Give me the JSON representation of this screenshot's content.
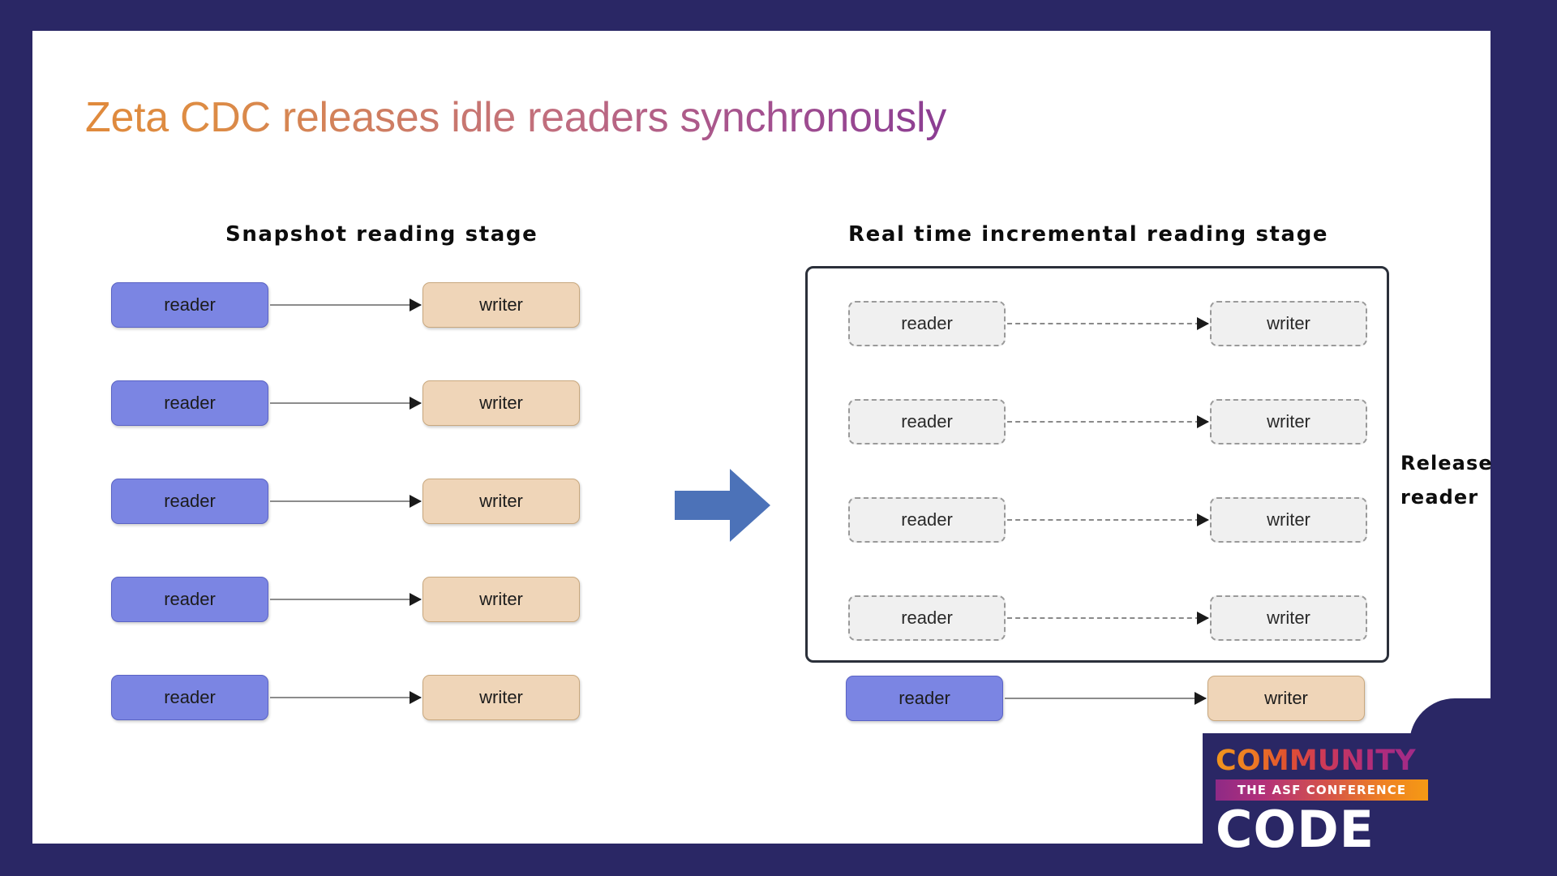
{
  "slide": {
    "title": "Zeta CDC releases idle readers synchronously",
    "background_color": "#2a2765",
    "canvas_color": "#ffffff"
  },
  "stages": {
    "left": {
      "caption": "Snapshot reading stage",
      "rows": [
        {
          "reader": "reader",
          "writer": "writer",
          "state": "active"
        },
        {
          "reader": "reader",
          "writer": "writer",
          "state": "active"
        },
        {
          "reader": "reader",
          "writer": "writer",
          "state": "active"
        },
        {
          "reader": "reader",
          "writer": "writer",
          "state": "active"
        },
        {
          "reader": "reader",
          "writer": "writer",
          "state": "active"
        }
      ]
    },
    "right": {
      "caption": "Real time incremental reading stage",
      "panel_rows": [
        {
          "reader": "reader",
          "writer": "writer",
          "state": "idle"
        },
        {
          "reader": "reader",
          "writer": "writer",
          "state": "idle"
        },
        {
          "reader": "reader",
          "writer": "writer",
          "state": "idle"
        },
        {
          "reader": "reader",
          "writer": "writer",
          "state": "idle"
        }
      ],
      "bottom_row": {
        "reader": "reader",
        "writer": "writer",
        "state": "active"
      },
      "annotation_line1": "Release",
      "annotation_line2": "reader"
    }
  },
  "transition_arrow": {
    "icon": "right-arrow-icon",
    "color": "#4c72b8"
  },
  "colors": {
    "reader_active_fill": "#7b85e3",
    "reader_active_border": "#5a63c4",
    "writer_active_fill": "#efd5b8",
    "writer_active_border": "#c9a87e",
    "idle_fill": "#f0f0f0",
    "idle_border": "#9a9a9a",
    "panel_border": "#2b303a",
    "connector": "#8c8c8c",
    "title_gradient_start": "#e08a3c",
    "title_gradient_end": "#8b3d93"
  },
  "logo": {
    "community": "COMMUNITY",
    "tagline": "THE ASF CONFERENCE",
    "code": "CODE",
    "plate_color": "#2a2765"
  }
}
